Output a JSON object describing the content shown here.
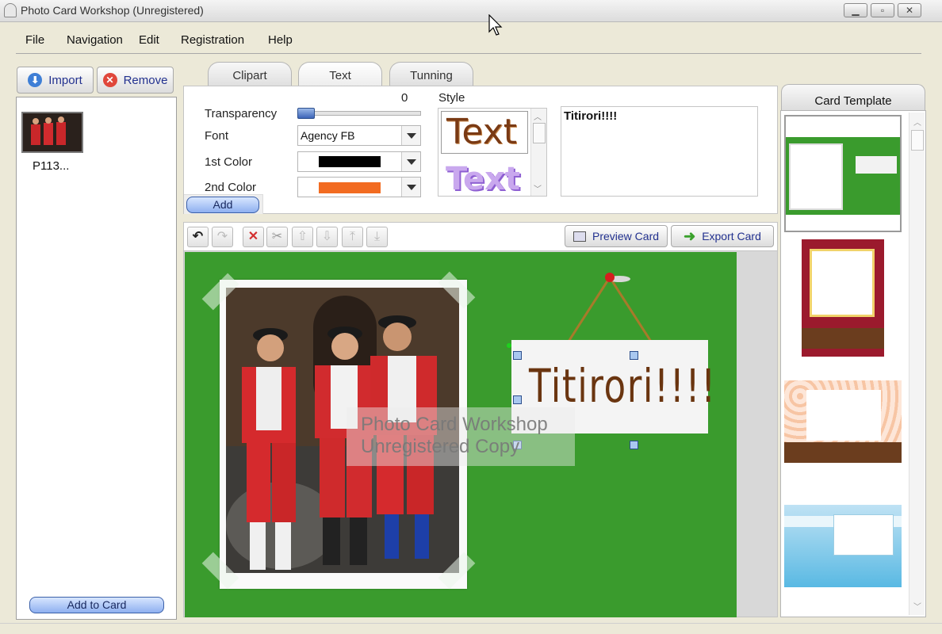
{
  "window": {
    "title": "Photo Card Workshop (Unregistered)"
  },
  "menu": [
    "File",
    "Navigation",
    "Edit",
    "Registration",
    "Help"
  ],
  "left": {
    "import_label": "Import",
    "remove_label": "Remove",
    "thumb_label": "P113...",
    "add_to_card_label": "Add to Card"
  },
  "tabs": [
    "Clipart",
    "Text",
    "Tunning"
  ],
  "text_panel": {
    "transparency_label": "Transparency",
    "transparency_value": "0",
    "transparency_level": 0,
    "font_label": "Font",
    "font_value": "Agency FB",
    "color1_label": "1st Color",
    "color1_value": "#000000",
    "color2_label": "2nd Color",
    "color2_value": "#f26b21",
    "add_label": "Add",
    "style_label": "Style",
    "style_samples": [
      "Text",
      "Text"
    ],
    "text_value": "Titirori!!!!"
  },
  "toolbar": {
    "icons": [
      "undo-icon",
      "redo-icon",
      "delete-icon",
      "cut-icon",
      "move-up-icon",
      "move-down-icon",
      "bring-to-front-icon",
      "send-to-back-icon"
    ],
    "preview_label": "Preview Card",
    "export_label": "Export Card"
  },
  "canvas": {
    "sign_text": "Titirori!!!!",
    "watermark_line1": "Photo Card Workshop",
    "watermark_line2": "Unregistered Copy",
    "card_color": "#3a9b2d"
  },
  "templates": {
    "title": "Card Template"
  }
}
